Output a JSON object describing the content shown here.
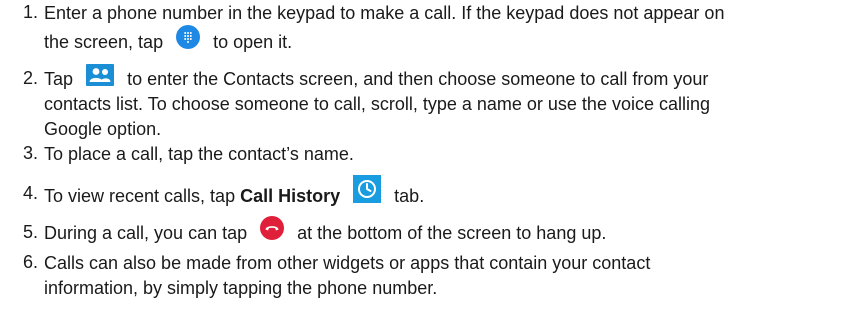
{
  "items": [
    {
      "number": "1.",
      "line1": "Enter a phone number in the keypad to make a call. If the keypad does not appear on",
      "line2_before": "the screen, tap",
      "line2_after": "to open it.",
      "icon": "dialpad-icon"
    },
    {
      "number": "2.",
      "line1_before": "Tap",
      "line1_after": "to enter the Contacts screen, and then choose someone to call from your",
      "line2": "contacts list. To choose someone to call, scroll, type a name or use the voice calling",
      "line3": "Google option.",
      "icon": "contacts-icon"
    },
    {
      "number": "3.",
      "line1": "To place a call, tap the contact’s name."
    },
    {
      "number": "4.",
      "line1_before": "To view recent calls, tap",
      "bold": "Call History",
      "line1_after": "tab.",
      "icon": "clock-icon"
    },
    {
      "number": "5.",
      "line1_before": "During a call, you can tap",
      "line1_after": "at the bottom of the screen to hang up.",
      "icon": "end-call-icon"
    },
    {
      "number": "6.",
      "line1": "Calls can also be made from other widgets or apps that contain your contact",
      "line2": "information, by simply tapping the phone number."
    }
  ],
  "colors": {
    "dialpad_blue": "#1e88e5",
    "contacts_blue": "#1b8fd6",
    "clock_blue": "#1a9ce0",
    "end_call_red": "#e0203a"
  }
}
